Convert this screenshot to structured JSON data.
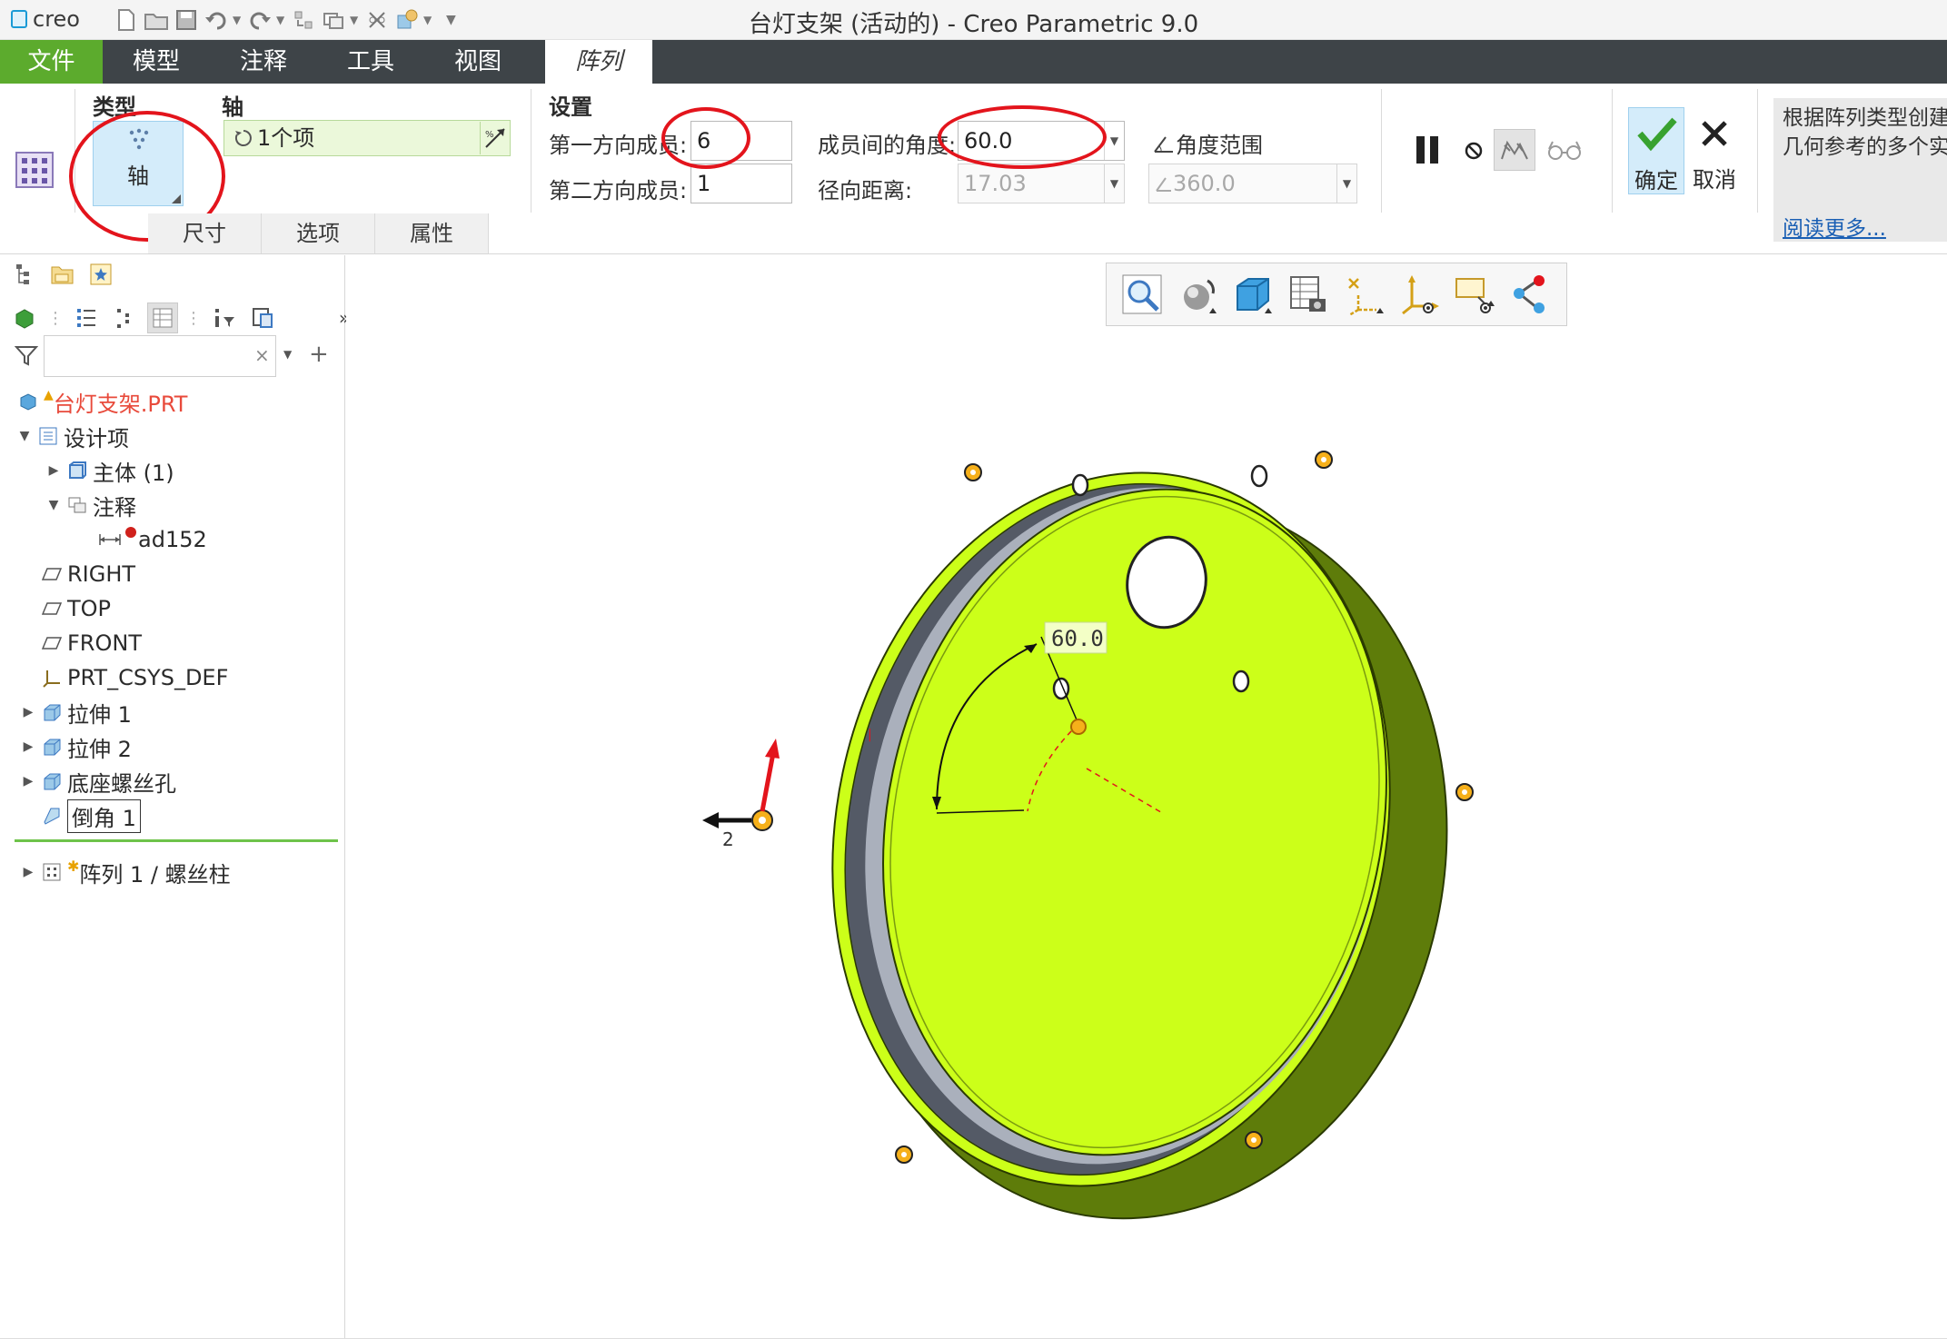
{
  "app": {
    "logo_text": "creo",
    "window_title": "台灯支架 (活动的) - Creo Parametric 9.0"
  },
  "ribbon_tabs": {
    "file": "文件",
    "model": "模型",
    "annotate": "注释",
    "tools": "工具",
    "view": "视图",
    "pattern": "阵列"
  },
  "ribbon": {
    "type_group_label": "类型",
    "type_axis_button": "轴",
    "axis_group_label": "轴",
    "axis_collector_value": "1个项",
    "settings_group_label": "设置",
    "first_dir_label": "第一方向成员:",
    "first_dir_value": "6",
    "second_dir_label": "第二方向成员:",
    "second_dir_value": "1",
    "angle_between_label": "成员间的角度:",
    "angle_between_value": "60.0",
    "radial_dist_label": "径向距离:",
    "radial_dist_value": "17.03",
    "angle_range_label": "角度范围",
    "angle_range_value": "360.0",
    "ok_label": "确定",
    "cancel_label": "取消",
    "subtabs": [
      "尺寸",
      "选项",
      "属性"
    ],
    "help_text": "根据阵列类型创建\n几何参考的多个实",
    "help_link": "阅读更多..."
  },
  "model_tree": {
    "root": "台灯支架.PRT",
    "items": [
      {
        "label": "设计项"
      },
      {
        "label": "主体 (1)"
      },
      {
        "label": "注释"
      },
      {
        "label": "ad152"
      },
      {
        "label": "RIGHT"
      },
      {
        "label": "TOP"
      },
      {
        "label": "FRONT"
      },
      {
        "label": "PRT_CSYS_DEF"
      },
      {
        "label": "拉伸 1"
      },
      {
        "label": "拉伸 2"
      },
      {
        "label": "底座螺丝孔"
      },
      {
        "label": "倒角 1"
      },
      {
        "label": "阵列 1 / 螺丝柱"
      }
    ]
  },
  "graphics": {
    "angle_dim_label": "60.0",
    "direction_label": "2"
  },
  "colors": {
    "file_tab": "#5cab2d",
    "ribbon_dark": "#3e4448",
    "selected_button": "#d4ecfa",
    "model_face": "#ccff19",
    "model_side": "#5e7c0a",
    "model_inner_wall": "#545a66",
    "annotation_red": "#e3141c",
    "tree_root_red": "#e84a3b"
  }
}
